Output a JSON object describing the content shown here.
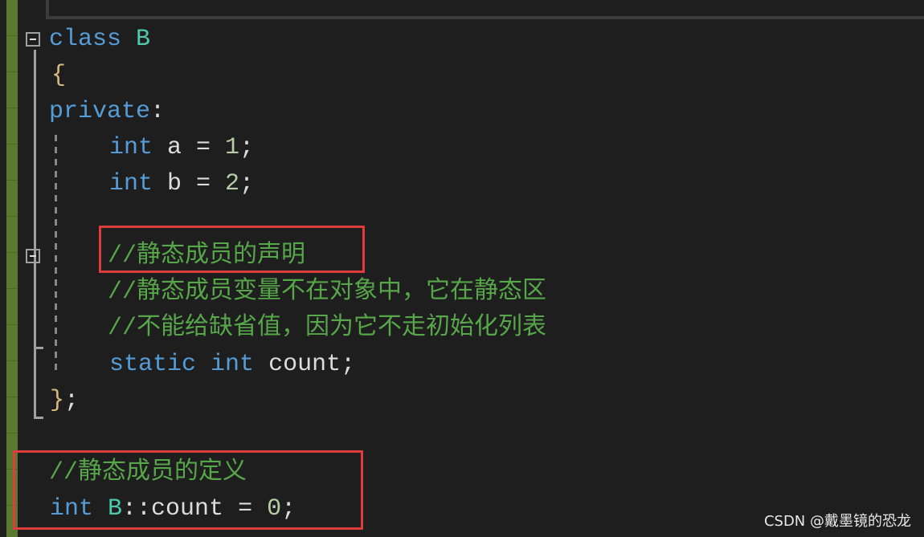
{
  "colors": {
    "keyword": "#569cd6",
    "type": "#4ec9b0",
    "comment": "#57a64a",
    "number": "#b5cea8",
    "highlight_box": "#e03c3c",
    "gutter": "#5a7a30"
  },
  "code": {
    "l1": {
      "kw": "class",
      "name": "B"
    },
    "l2": "{",
    "l3": {
      "kw": "private",
      "rest": ":"
    },
    "l4": {
      "kw": "int",
      "rest": " a = ",
      "num": "1",
      "end": ";"
    },
    "l5": {
      "kw": "int",
      "rest": " b = ",
      "num": "2",
      "end": ";"
    },
    "l7": "//静态成员的声明",
    "l8": "//静态成员变量不在对象中，它在静态区",
    "l9": "//不能给缺省值，因为它不走初始化列表",
    "l10": {
      "kw1": "static",
      "kw2": "int",
      "rest": " count;"
    },
    "l11": {
      "brace": "}",
      "end": ";"
    },
    "l13": "//静态成员的定义",
    "l14": {
      "kw": "int",
      "name": "B",
      "rest": "::count = ",
      "num": "0",
      "end": ";"
    }
  },
  "watermark": "CSDN @戴墨镜的恐龙"
}
